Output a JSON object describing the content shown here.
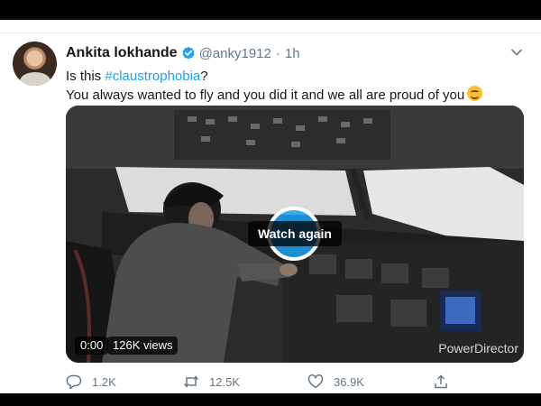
{
  "tweet": {
    "author_name": "Ankita lokhande",
    "handle": "@anky1912",
    "separator": "·",
    "time": "1h",
    "text_line1_prefix": "Is this ",
    "hashtag": "#claustrophobia",
    "text_line1_suffix": "?",
    "text_line2": "You always wanted to fly and you did it and we all are proud of you",
    "emoji": "smiling-face-emoji"
  },
  "video": {
    "watch_again_label": "Watch again",
    "timestamp": "0:00",
    "views": "126K views",
    "watermark": "PowerDirector"
  },
  "actions": {
    "replies": "1.2K",
    "retweets": "12.5K",
    "likes": "36.9K"
  },
  "colors": {
    "link": "#1da1f2",
    "secondary_text": "#657786",
    "primary_text": "#14171a"
  }
}
